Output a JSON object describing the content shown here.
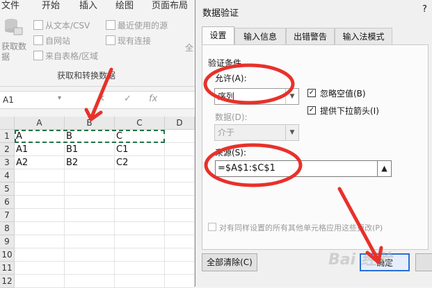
{
  "excel": {
    "menu_tabs": [
      "文件",
      "开始",
      "插入",
      "绘图",
      "页面布局"
    ],
    "ribbon": {
      "get_data_label": "获取数\n据",
      "from_text_csv": "从文本/CSV",
      "from_web": "自网站",
      "from_table_range": "来自表格/区域",
      "recent_sources": "最近使用的源",
      "existing_connections": "现有连接",
      "all_refresh_partial": "全",
      "group_label": "获取和转换数据"
    },
    "name_box": "A1",
    "formula_symbols": [
      "✕",
      "✓",
      "fx"
    ],
    "columns": [
      "A",
      "B",
      "C",
      "D"
    ],
    "rows": [
      "1",
      "2",
      "3",
      "4",
      "5",
      "6",
      "7",
      "8",
      "9",
      "10",
      "11",
      "12"
    ],
    "cells": [
      [
        "A",
        "B",
        "C"
      ],
      [
        "A1",
        "B1",
        "C1"
      ],
      [
        "A2",
        "B2",
        "C2"
      ]
    ]
  },
  "dialog": {
    "title": "数据验证",
    "help": "?",
    "tabs": [
      "设置",
      "输入信息",
      "出错警告",
      "输入法模式"
    ],
    "active_tab": "设置",
    "section_title": "验证条件",
    "allow_label": "允许(A):",
    "allow_value": "序列",
    "ignore_blank_label": "忽略空值(B)",
    "ignore_blank_checked": true,
    "dropdown_label": "提供下拉箭头(I)",
    "dropdown_checked": true,
    "data_label": "数据(D):",
    "data_value": "介于",
    "source_label": "来源(S):",
    "source_value": "=$A$1:$C$1",
    "apply_all_label": "对有同样设置的所有其他单元格应用这些更改(P)",
    "clear_all_button": "全部清除(C)",
    "ok_button": "确定"
  },
  "watermark": "Bai 经验",
  "colors": {
    "annotation_red": "#e8312a",
    "excel_green": "#217346",
    "default_button_blue": "#2a6fd6"
  }
}
